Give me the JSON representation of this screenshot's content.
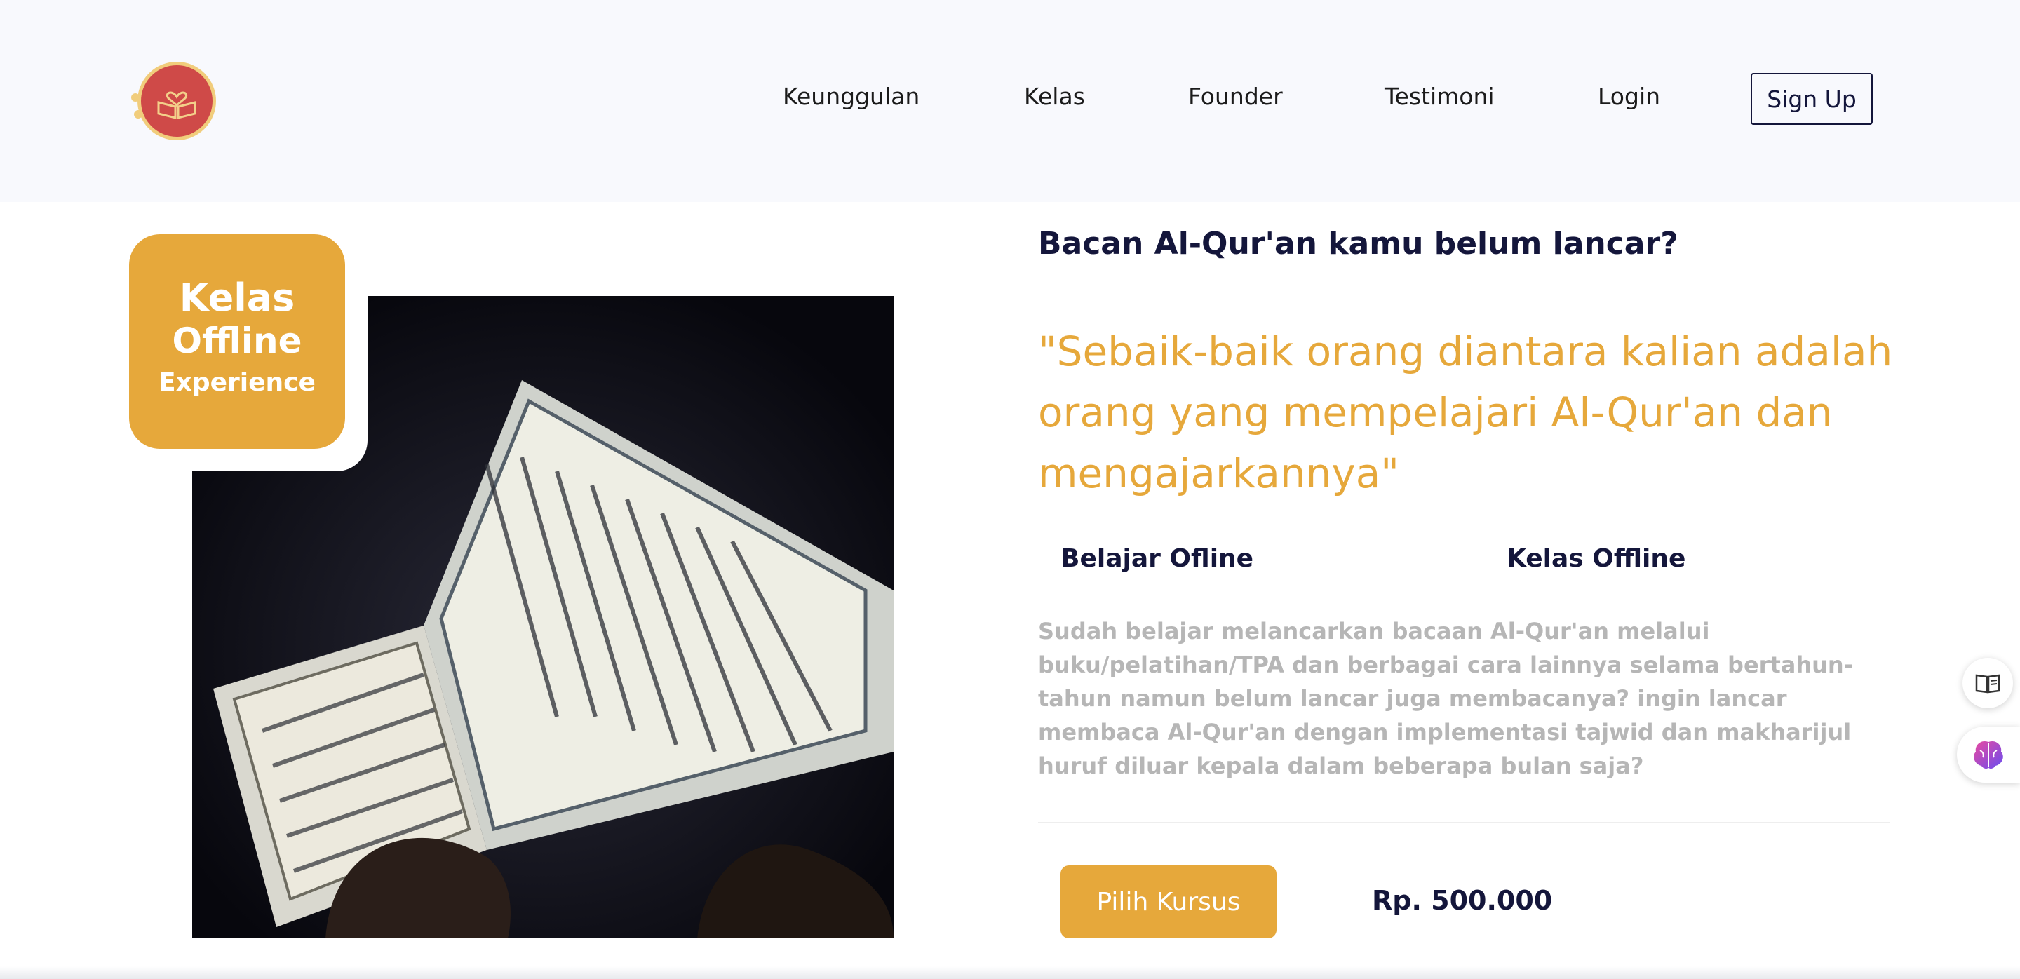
{
  "nav": {
    "items": [
      "Keunggulan",
      "Kelas",
      "Founder",
      "Testimoni",
      "Login"
    ],
    "signup_label": "Sign Up"
  },
  "badge": {
    "line1": "Kelas",
    "line2": "Offline",
    "line3": "Experience"
  },
  "hero": {
    "headline": "Bacan Al-Qur'an kamu belum lancar?",
    "quote": "\"Sebaik-baik orang diantara kalian adalah orang yang mempelajari Al-Qur'an dan mengajarkannya\"",
    "features": [
      "Belajar Ofline",
      "Kelas Offline"
    ],
    "description": "Sudah belajar melancarkan bacaan Al-Qur'an melalui buku/pelatihan/TPA dan berbagai cara lainnya selama bertahun-tahun namun belum lancar juga membacanya? ingin lancar membaca Al-Qur'an dengan implementasi tajwid dan makharijul huruf diluar kepala dalam beberapa bulan saja?",
    "button_label": "Pilih Kursus",
    "price": "Rp. 500.000"
  },
  "colors": {
    "accent": "#e6a83b",
    "navy": "#14163b",
    "logo_red": "#cf4a48",
    "muted_text": "#b6b6b6"
  },
  "icons": {
    "logo": "quran-heart-logo",
    "side_top": "book-icon",
    "side_bottom": "brain-icon"
  }
}
